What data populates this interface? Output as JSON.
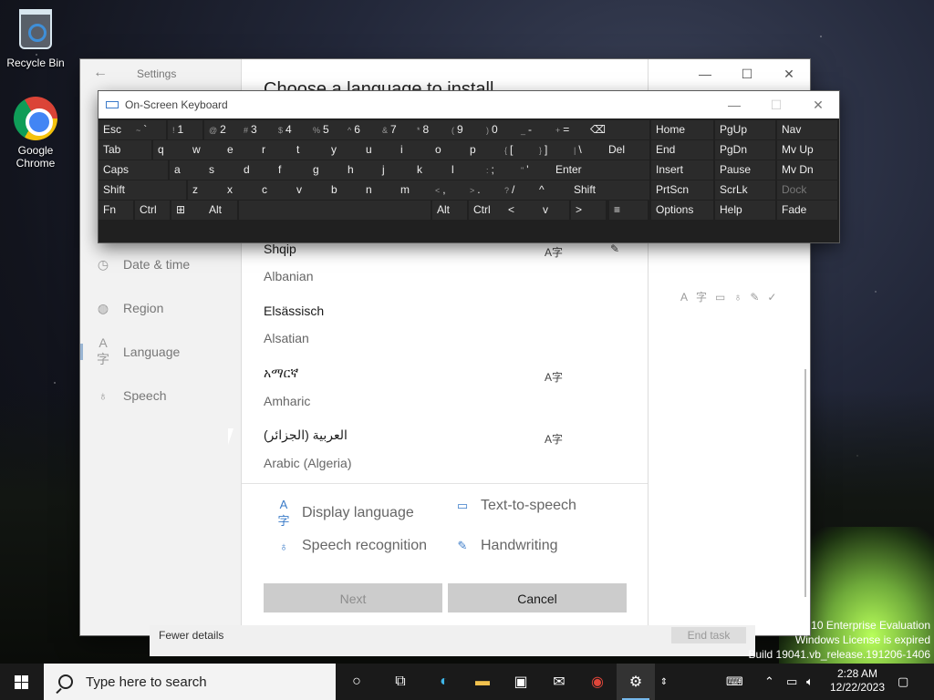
{
  "desktop": {
    "icons": [
      {
        "label": "Recycle Bin",
        "icon": "recycle-bin-icon"
      },
      {
        "label": "Google Chrome",
        "icon": "chrome-icon"
      }
    ],
    "watermark": {
      "line1": "s 10 Enterprise Evaluation",
      "line2": "Windows License is expired",
      "line3": "Build 19041.vb_release.191206-1406"
    }
  },
  "settings": {
    "app_title": "Settings",
    "nav": [
      {
        "label": "Date & time",
        "icon": "clock-icon"
      },
      {
        "label": "Region",
        "icon": "globe-icon"
      },
      {
        "label": "Language",
        "icon": "language-icon"
      },
      {
        "label": "Speech",
        "icon": "microphone-icon"
      }
    ],
    "dialog": {
      "title": "Choose a language to install",
      "languages": [
        {
          "native": "Shqip",
          "english": "Albanian"
        },
        {
          "native": "Elsässisch",
          "english": "Alsatian"
        },
        {
          "native": "አማርኛ",
          "english": "Amharic"
        },
        {
          "native": "العربية (الجزائر)",
          "english": "Arabic (Algeria)"
        }
      ],
      "legend": {
        "display_language": "Display language",
        "text_to_speech": "Text-to-speech",
        "speech_recognition": "Speech recognition",
        "handwriting": "Handwriting"
      },
      "buttons": {
        "next": "Next",
        "cancel": "Cancel"
      }
    }
  },
  "task_manager": {
    "fewer_details": "Fewer details",
    "end_task": "End task"
  },
  "osk": {
    "title": "On-Screen Keyboard",
    "rows": [
      [
        "Esc",
        "~ `",
        "! 1",
        "@ 2",
        "# 3",
        "$ 4",
        "% 5",
        "^ 6",
        "& 7",
        "* 8",
        "( 9",
        ") 0",
        "_ -",
        "+ =",
        "⌫",
        "Home",
        "PgUp",
        "Nav"
      ],
      [
        "Tab",
        "q",
        "w",
        "e",
        "r",
        "t",
        "y",
        "u",
        "i",
        "o",
        "p",
        "{ [",
        "} ]",
        "| \\",
        "Del",
        "End",
        "PgDn",
        "Mv Up"
      ],
      [
        "Caps",
        "a",
        "s",
        "d",
        "f",
        "g",
        "h",
        "j",
        "k",
        "l",
        ": ;",
        "\" '",
        "Enter",
        "Insert",
        "Pause",
        "Mv Dn"
      ],
      [
        "Shift",
        "z",
        "x",
        "c",
        "v",
        "b",
        "n",
        "m",
        "< ,",
        "> .",
        "? /",
        "^",
        "Shift",
        "PrtScn",
        "ScrLk",
        "Dock"
      ],
      [
        "Fn",
        "Ctrl",
        "⊞",
        "Alt",
        "",
        "Alt",
        "Ctrl",
        "<",
        "v",
        ">",
        "≡",
        "Options",
        "Help",
        "Fade"
      ]
    ]
  },
  "taskbar": {
    "search_placeholder": "Type here to search",
    "clock_time": "2:28 AM",
    "clock_date": "12/22/2023",
    "pinned": [
      "cortana-icon",
      "task-view-icon",
      "edge-icon",
      "file-explorer-icon",
      "store-icon",
      "mail-icon",
      "chrome-icon",
      "settings-gear-icon"
    ]
  },
  "colors": {
    "accent": "#3a7bc8",
    "taskbar": "#1a1a1a",
    "osk_key": "#2b2b2b"
  }
}
